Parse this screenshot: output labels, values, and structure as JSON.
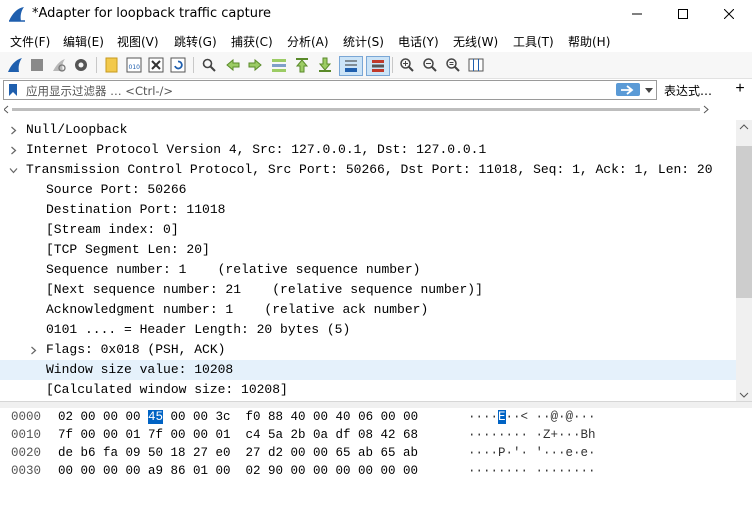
{
  "window": {
    "title": "*Adapter for loopback traffic capture",
    "minimize_glyph": "—",
    "maximize_glyph": "☐",
    "close_glyph": "✕"
  },
  "menu": [
    "文件(F)",
    "编辑(E)",
    "视图(V)",
    "跳转(G)",
    "捕获(C)",
    "分析(A)",
    "统计(S)",
    "电话(Y)",
    "无线(W)",
    "工具(T)",
    "帮助(H)"
  ],
  "toolbar": {
    "icons": [
      "shark-fin-start-icon",
      "stop-square-icon",
      "restart-shark-icon",
      "options-gear-icon",
      "open-folder-icon",
      "save-file-icon",
      "close-file-icon",
      "reload-icon",
      "find-icon",
      "go-back-icon",
      "go-forward-icon",
      "go-to-packet-icon",
      "first-packet-icon",
      "last-packet-icon",
      "autoscroll-icon",
      "colorize-icon",
      "zoom-in-icon",
      "zoom-out-icon",
      "zoom-reset-icon",
      "resize-columns-icon"
    ]
  },
  "filter": {
    "placeholder": "应用显示过滤器 … <Ctrl-/>",
    "expression_label": "表达式…",
    "add_label": "+"
  },
  "details": {
    "rows": [
      {
        "indent": 0,
        "twisty": "collapsed",
        "text": "Null/Loopback"
      },
      {
        "indent": 0,
        "twisty": "collapsed",
        "text": "Internet Protocol Version 4, Src: 127.0.0.1, Dst: 127.0.0.1"
      },
      {
        "indent": 0,
        "twisty": "expanded",
        "text": "Transmission Control Protocol, Src Port: 50266, Dst Port: 11018, Seq: 1, Ack: 1, Len: 20"
      },
      {
        "indent": 1,
        "twisty": "none",
        "text": "Source Port: 50266"
      },
      {
        "indent": 1,
        "twisty": "none",
        "text": "Destination Port: 11018"
      },
      {
        "indent": 1,
        "twisty": "none",
        "text": "[Stream index: 0]"
      },
      {
        "indent": 1,
        "twisty": "none",
        "text": "[TCP Segment Len: 20]"
      },
      {
        "indent": 1,
        "twisty": "none",
        "text": "Sequence number: 1    (relative sequence number)"
      },
      {
        "indent": 1,
        "twisty": "none",
        "text": "[Next sequence number: 21    (relative sequence number)]"
      },
      {
        "indent": 1,
        "twisty": "none",
        "text": "Acknowledgment number: 1    (relative ack number)"
      },
      {
        "indent": 1,
        "twisty": "none",
        "text": "0101 .... = Header Length: 20 bytes (5)"
      },
      {
        "indent": 1,
        "twisty": "collapsed",
        "text": "Flags: 0x018 (PSH, ACK)"
      },
      {
        "indent": 1,
        "twisty": "none",
        "text": "Window size value: 10208",
        "selected": true
      },
      {
        "indent": 1,
        "twisty": "none",
        "text": "[Calculated window size: 10208]"
      }
    ]
  },
  "hex": {
    "rows": [
      {
        "offset": "0000",
        "pre": "02 00 00 00 ",
        "hl": "45",
        "post": " 00 00 3c  f0 88 40 00 40 06 00 00",
        "ascii_pre": "····",
        "ascii_hl": "E",
        "ascii_post": "··< ··@·@···"
      },
      {
        "offset": "0010",
        "pre": "7f 00 00 01 7f 00 00 01  c4 5a 2b 0a df 08 42 68",
        "hl": "",
        "post": "",
        "ascii_pre": "········ ·Z+···Bh",
        "ascii_hl": "",
        "ascii_post": ""
      },
      {
        "offset": "0020",
        "pre": "de b6 fa 09 50 18 27 e0  27 d2 00 00 65 ab 65 ab",
        "hl": "",
        "post": "",
        "ascii_pre": "····P·'· '···e·e·",
        "ascii_hl": "",
        "ascii_post": ""
      },
      {
        "offset": "0030",
        "pre": "00 00 00 00 a9 86 01 00  02 90 00 00 00 00 00 00",
        "hl": "",
        "post": "",
        "ascii_pre": "········ ········",
        "ascii_hl": "",
        "ascii_post": ""
      }
    ]
  },
  "colors": {
    "accent": "#0063c4",
    "selected_row": "#e5f1fb",
    "apply_arrow": "#5a9ad6"
  }
}
